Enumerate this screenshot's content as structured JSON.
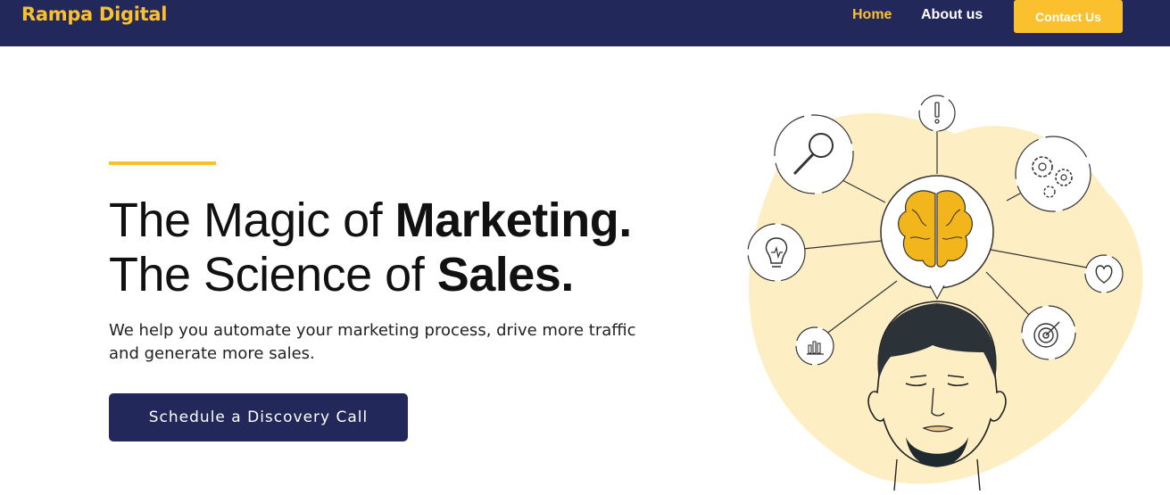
{
  "nav": {
    "brand": "Rampa Digital",
    "links": [
      {
        "label": "Home",
        "active": true
      },
      {
        "label": "About us",
        "active": false
      }
    ],
    "contact_label": "Contact Us"
  },
  "hero": {
    "headline_1_light": "The Magic of ",
    "headline_1_bold": "Marketing.",
    "headline_2_light": "The Science of ",
    "headline_2_bold": "Sales.",
    "subtext": "We help you automate your marketing process, drive more traffic and generate more sales.",
    "cta_label": "Schedule a Discovery Call"
  },
  "illustration": {
    "icons": [
      "search-icon",
      "alert-icon",
      "gears-icon",
      "lightbulb-icon",
      "heart-icon",
      "bar-chart-icon",
      "target-icon",
      "brain-icon"
    ]
  },
  "colors": {
    "navy": "#23285a",
    "accent_yellow": "#fbc02d",
    "blob": "#fdeec4",
    "brain": "#f2b61c"
  }
}
